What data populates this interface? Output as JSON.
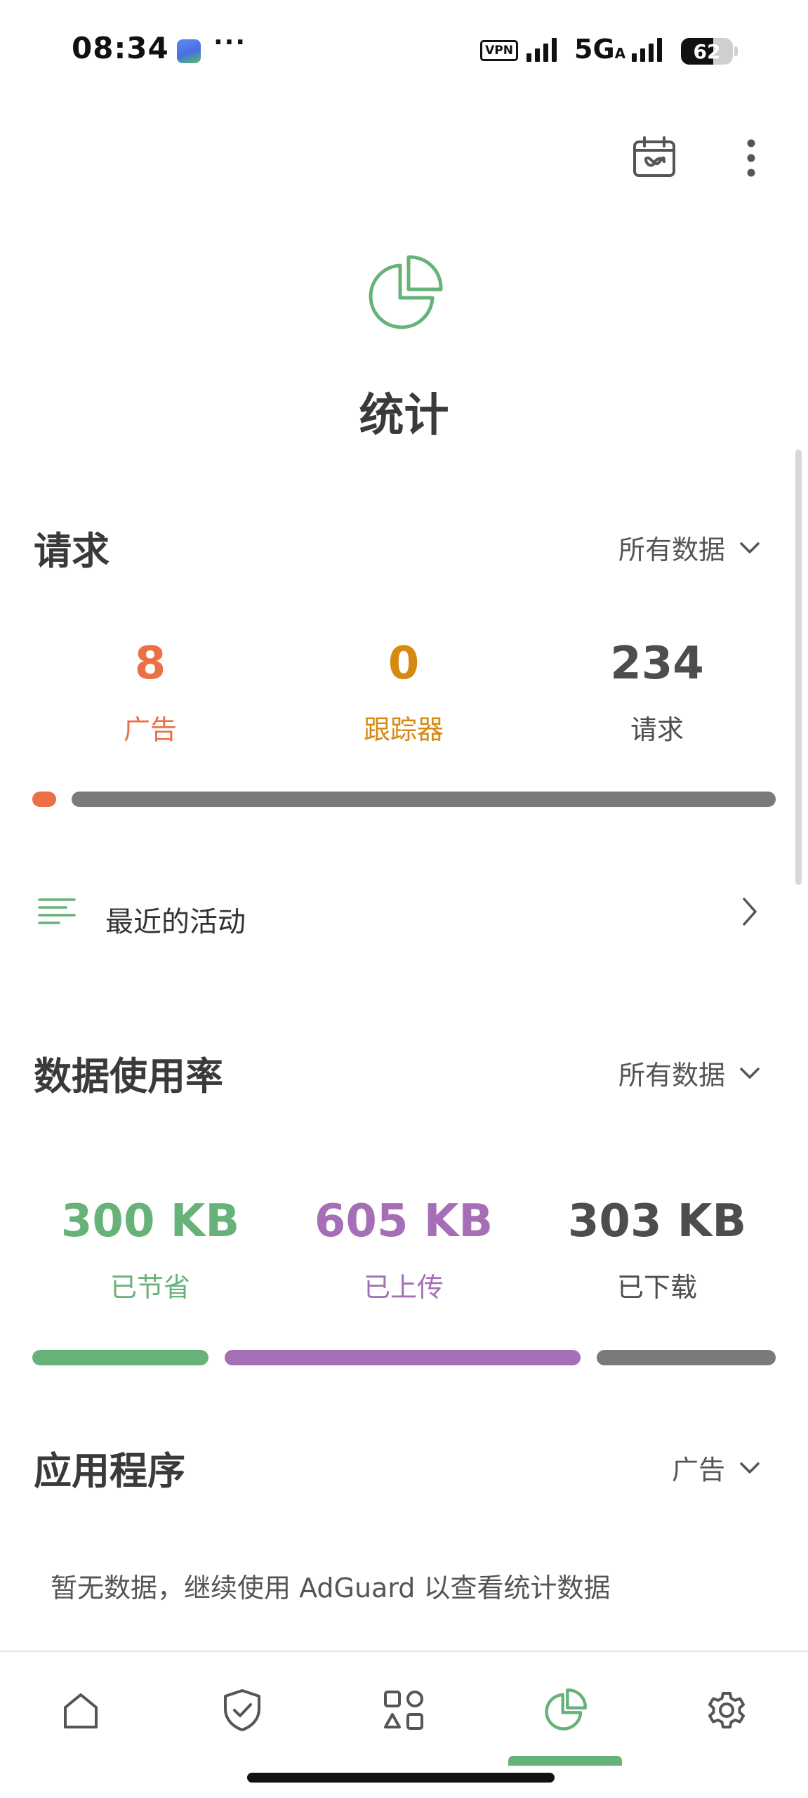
{
  "status_bar": {
    "time": "08:34",
    "more": "···",
    "vpn": "VPN",
    "network": "5G",
    "network_sub": "A",
    "battery": "62"
  },
  "header": {
    "title": "统计",
    "icons": {
      "date_range": "calendar-icon",
      "more": "more-vertical-icon",
      "hero": "pie-chart-icon"
    }
  },
  "requests": {
    "title": "请求",
    "filter": "所有数据",
    "stats": [
      {
        "value": "8",
        "label": "广告",
        "color": "#ec7046"
      },
      {
        "value": "0",
        "label": "跟踪器",
        "color": "#d68a12"
      },
      {
        "value": "234",
        "label": "请求",
        "color": "#4d4d4d"
      }
    ]
  },
  "recent_activity": {
    "label": "最近的活动"
  },
  "data_usage": {
    "title": "数据使用率",
    "filter": "所有数据",
    "stats": [
      {
        "value": "300 KB",
        "label": "已节省",
        "color": "#67b279"
      },
      {
        "value": "605 KB",
        "label": "已上传",
        "color": "#a66fb5"
      },
      {
        "value": "303 KB",
        "label": "已下载",
        "color": "#4d4d4d"
      }
    ]
  },
  "apps": {
    "title": "应用程序",
    "filter": "广告",
    "empty_text": "暂无数据，继续使用 AdGuard 以查看统计数据"
  },
  "bottom_nav": {
    "items": [
      {
        "icon": "home-icon"
      },
      {
        "icon": "shield-check-icon"
      },
      {
        "icon": "apps-icon"
      },
      {
        "icon": "pie-chart-icon",
        "active": true
      },
      {
        "icon": "settings-gear-icon"
      }
    ],
    "active_color": "#67b279"
  }
}
